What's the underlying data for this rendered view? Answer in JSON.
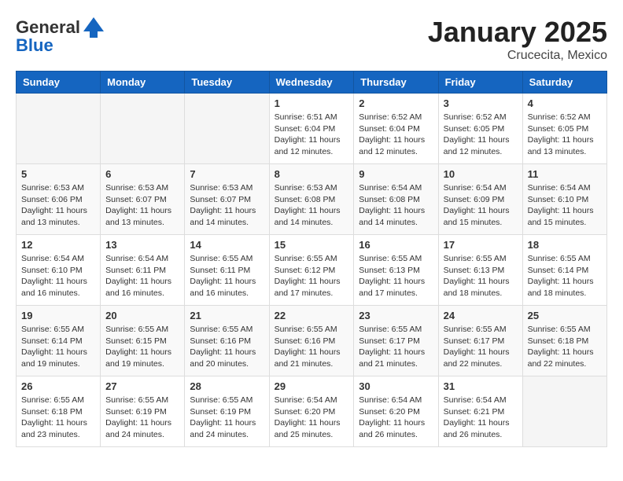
{
  "header": {
    "logo_general": "General",
    "logo_blue": "Blue",
    "month": "January 2025",
    "location": "Crucecita, Mexico"
  },
  "days_of_week": [
    "Sunday",
    "Monday",
    "Tuesday",
    "Wednesday",
    "Thursday",
    "Friday",
    "Saturday"
  ],
  "weeks": [
    [
      {
        "day": "",
        "info": ""
      },
      {
        "day": "",
        "info": ""
      },
      {
        "day": "",
        "info": ""
      },
      {
        "day": "1",
        "info": "Sunrise: 6:51 AM\nSunset: 6:04 PM\nDaylight: 11 hours and 12 minutes."
      },
      {
        "day": "2",
        "info": "Sunrise: 6:52 AM\nSunset: 6:04 PM\nDaylight: 11 hours and 12 minutes."
      },
      {
        "day": "3",
        "info": "Sunrise: 6:52 AM\nSunset: 6:05 PM\nDaylight: 11 hours and 12 minutes."
      },
      {
        "day": "4",
        "info": "Sunrise: 6:52 AM\nSunset: 6:05 PM\nDaylight: 11 hours and 13 minutes."
      }
    ],
    [
      {
        "day": "5",
        "info": "Sunrise: 6:53 AM\nSunset: 6:06 PM\nDaylight: 11 hours and 13 minutes."
      },
      {
        "day": "6",
        "info": "Sunrise: 6:53 AM\nSunset: 6:07 PM\nDaylight: 11 hours and 13 minutes."
      },
      {
        "day": "7",
        "info": "Sunrise: 6:53 AM\nSunset: 6:07 PM\nDaylight: 11 hours and 14 minutes."
      },
      {
        "day": "8",
        "info": "Sunrise: 6:53 AM\nSunset: 6:08 PM\nDaylight: 11 hours and 14 minutes."
      },
      {
        "day": "9",
        "info": "Sunrise: 6:54 AM\nSunset: 6:08 PM\nDaylight: 11 hours and 14 minutes."
      },
      {
        "day": "10",
        "info": "Sunrise: 6:54 AM\nSunset: 6:09 PM\nDaylight: 11 hours and 15 minutes."
      },
      {
        "day": "11",
        "info": "Sunrise: 6:54 AM\nSunset: 6:10 PM\nDaylight: 11 hours and 15 minutes."
      }
    ],
    [
      {
        "day": "12",
        "info": "Sunrise: 6:54 AM\nSunset: 6:10 PM\nDaylight: 11 hours and 16 minutes."
      },
      {
        "day": "13",
        "info": "Sunrise: 6:54 AM\nSunset: 6:11 PM\nDaylight: 11 hours and 16 minutes."
      },
      {
        "day": "14",
        "info": "Sunrise: 6:55 AM\nSunset: 6:11 PM\nDaylight: 11 hours and 16 minutes."
      },
      {
        "day": "15",
        "info": "Sunrise: 6:55 AM\nSunset: 6:12 PM\nDaylight: 11 hours and 17 minutes."
      },
      {
        "day": "16",
        "info": "Sunrise: 6:55 AM\nSunset: 6:13 PM\nDaylight: 11 hours and 17 minutes."
      },
      {
        "day": "17",
        "info": "Sunrise: 6:55 AM\nSunset: 6:13 PM\nDaylight: 11 hours and 18 minutes."
      },
      {
        "day": "18",
        "info": "Sunrise: 6:55 AM\nSunset: 6:14 PM\nDaylight: 11 hours and 18 minutes."
      }
    ],
    [
      {
        "day": "19",
        "info": "Sunrise: 6:55 AM\nSunset: 6:14 PM\nDaylight: 11 hours and 19 minutes."
      },
      {
        "day": "20",
        "info": "Sunrise: 6:55 AM\nSunset: 6:15 PM\nDaylight: 11 hours and 19 minutes."
      },
      {
        "day": "21",
        "info": "Sunrise: 6:55 AM\nSunset: 6:16 PM\nDaylight: 11 hours and 20 minutes."
      },
      {
        "day": "22",
        "info": "Sunrise: 6:55 AM\nSunset: 6:16 PM\nDaylight: 11 hours and 21 minutes."
      },
      {
        "day": "23",
        "info": "Sunrise: 6:55 AM\nSunset: 6:17 PM\nDaylight: 11 hours and 21 minutes."
      },
      {
        "day": "24",
        "info": "Sunrise: 6:55 AM\nSunset: 6:17 PM\nDaylight: 11 hours and 22 minutes."
      },
      {
        "day": "25",
        "info": "Sunrise: 6:55 AM\nSunset: 6:18 PM\nDaylight: 11 hours and 22 minutes."
      }
    ],
    [
      {
        "day": "26",
        "info": "Sunrise: 6:55 AM\nSunset: 6:18 PM\nDaylight: 11 hours and 23 minutes."
      },
      {
        "day": "27",
        "info": "Sunrise: 6:55 AM\nSunset: 6:19 PM\nDaylight: 11 hours and 24 minutes."
      },
      {
        "day": "28",
        "info": "Sunrise: 6:55 AM\nSunset: 6:19 PM\nDaylight: 11 hours and 24 minutes."
      },
      {
        "day": "29",
        "info": "Sunrise: 6:54 AM\nSunset: 6:20 PM\nDaylight: 11 hours and 25 minutes."
      },
      {
        "day": "30",
        "info": "Sunrise: 6:54 AM\nSunset: 6:20 PM\nDaylight: 11 hours and 26 minutes."
      },
      {
        "day": "31",
        "info": "Sunrise: 6:54 AM\nSunset: 6:21 PM\nDaylight: 11 hours and 26 minutes."
      },
      {
        "day": "",
        "info": ""
      }
    ]
  ]
}
